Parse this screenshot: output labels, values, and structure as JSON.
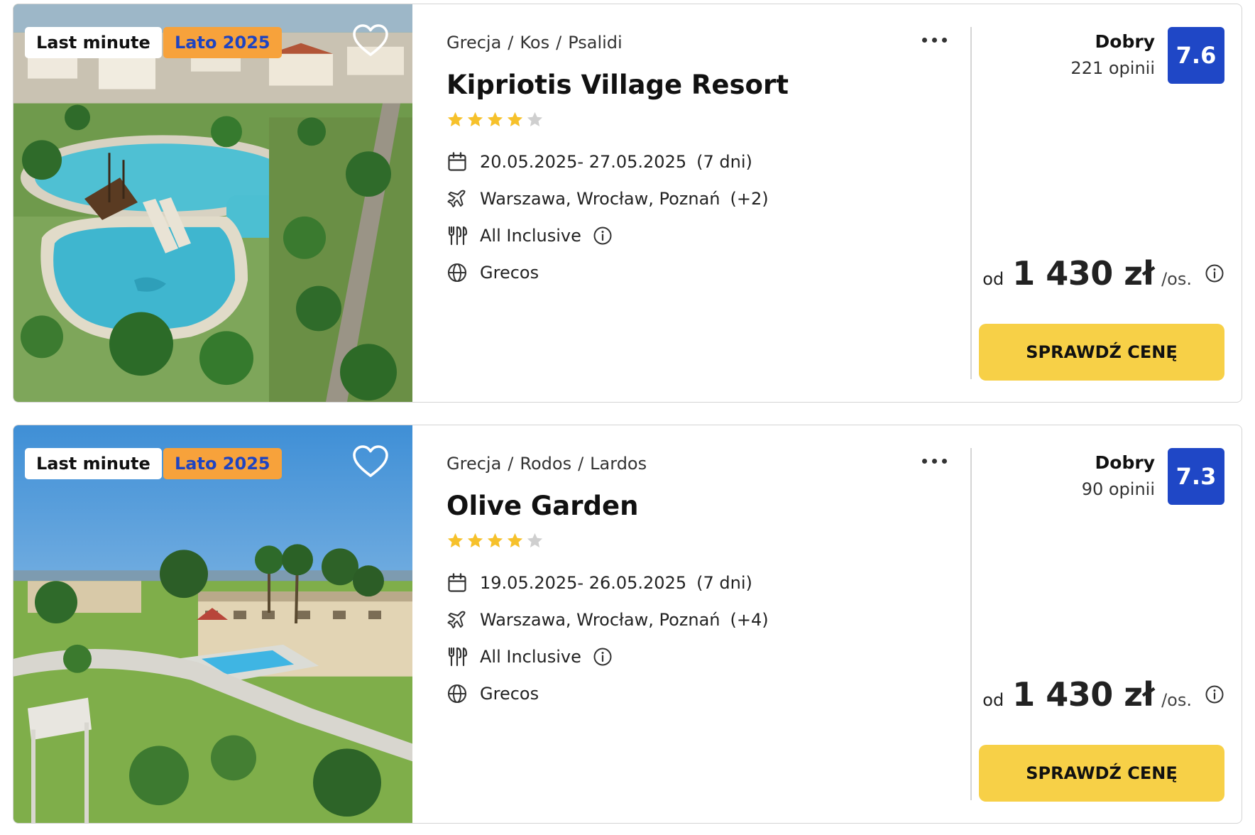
{
  "colors": {
    "score_bg": "#1f47c6",
    "cta_bg": "#f7d047",
    "season_badge_bg": "#f7a23b",
    "season_badge_text": "#1f44c1",
    "star_filled": "#f6c12b",
    "star_empty": "#cfcfcf"
  },
  "icons": {
    "favorite": "heart-icon",
    "more": "more-dots-icon",
    "dates": "calendar-icon",
    "departure": "airplane-icon",
    "board": "cutlery-icon",
    "operator": "globe-icon",
    "info": "info-icon",
    "star": "star-icon"
  },
  "offers": [
    {
      "badges": {
        "last_minute": "Last minute",
        "season": "Lato 2025"
      },
      "location": {
        "country": "Grecja",
        "island": "Kos",
        "town": "Psalidi"
      },
      "breadcrumb_separator": "/",
      "hotel_name": "Kipriotis Village Resort",
      "stars_rating": 4,
      "stars_max": 5,
      "dates": "20.05.2025- 27.05.2025",
      "duration": "(7 dni)",
      "departure_cities": "Warszawa, Wrocław, Poznań",
      "departure_extra": "(+2)",
      "board": "All Inclusive",
      "operator": "Grecos",
      "rating_label": "Dobry",
      "reviews": "221 opinii",
      "score": "7.6",
      "price_prefix": "od",
      "price": "1 430 zł",
      "price_suffix": "/os.",
      "cta_label": "SPRAWDŹ CENĘ"
    },
    {
      "badges": {
        "last_minute": "Last minute",
        "season": "Lato 2025"
      },
      "location": {
        "country": "Grecja",
        "island": "Rodos",
        "town": "Lardos"
      },
      "breadcrumb_separator": "/",
      "hotel_name": "Olive Garden",
      "stars_rating": 4,
      "stars_max": 5,
      "dates": "19.05.2025- 26.05.2025",
      "duration": "(7 dni)",
      "departure_cities": "Warszawa, Wrocław, Poznań",
      "departure_extra": "(+4)",
      "board": "All Inclusive",
      "operator": "Grecos",
      "rating_label": "Dobry",
      "reviews": "90 opinii",
      "score": "7.3",
      "price_prefix": "od",
      "price": "1 430 zł",
      "price_suffix": "/os.",
      "cta_label": "SPRAWDŹ CENĘ"
    }
  ]
}
